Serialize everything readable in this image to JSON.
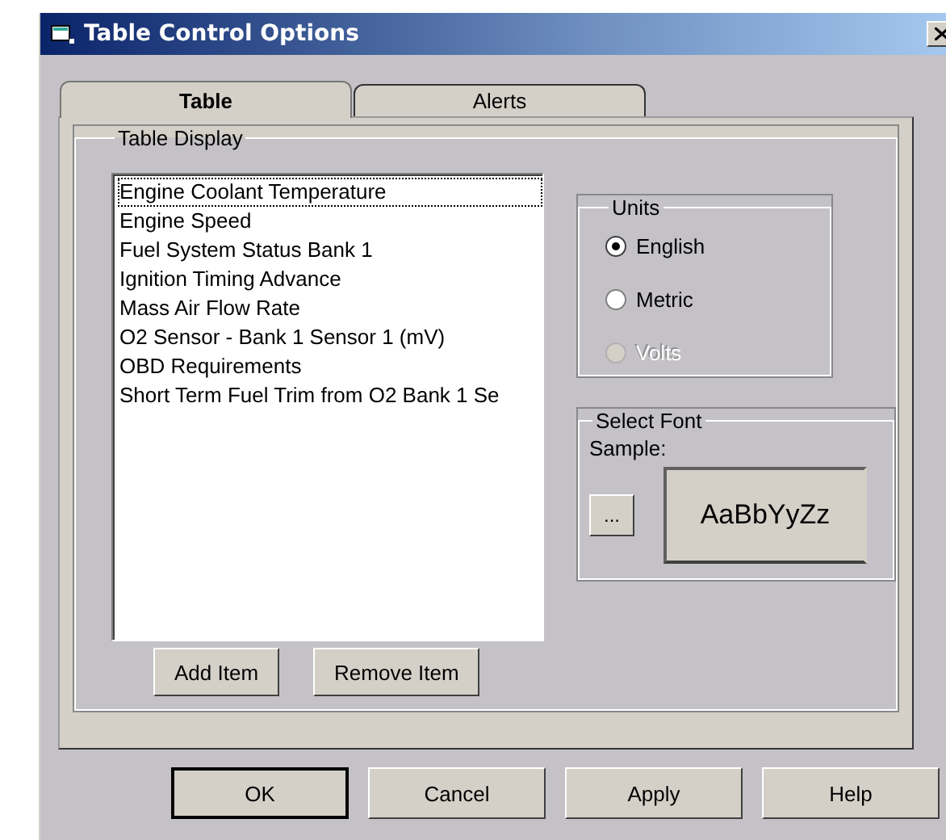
{
  "window": {
    "title": "Table Control Options"
  },
  "tabs": [
    {
      "label": "Table",
      "selected": true
    },
    {
      "label": "Alerts",
      "selected": false
    }
  ],
  "table_display": {
    "title": "Table Display",
    "list": [
      {
        "label": "Engine Coolant Temperature",
        "focused": true
      },
      {
        "label": "Engine Speed",
        "focused": false
      },
      {
        "label": "Fuel System Status Bank 1",
        "focused": false
      },
      {
        "label": "Ignition Timing Advance",
        "focused": false
      },
      {
        "label": "Mass Air Flow Rate",
        "focused": false
      },
      {
        "label": "O2 Sensor - Bank 1 Sensor 1 (mV)",
        "focused": false
      },
      {
        "label": "OBD Requirements",
        "focused": false
      },
      {
        "label": "Short Term Fuel Trim from O2 Bank 1 Se",
        "focused": false
      }
    ],
    "list_buttons": [
      "Add Item",
      "Remove Item"
    ],
    "units": {
      "title": "Units",
      "options": [
        {
          "label": "English",
          "selected": true,
          "disabled": false
        },
        {
          "label": "Metric",
          "selected": false,
          "disabled": false
        },
        {
          "label": "Volts",
          "selected": false,
          "disabled": true
        }
      ]
    },
    "font": {
      "title": "Select Font",
      "sample_label": "Sample:",
      "browse_button": "...",
      "sample_text": "AaBbYyZz"
    }
  },
  "buttons": [
    {
      "label": "OK",
      "default": true
    },
    {
      "label": "Cancel",
      "default": false
    },
    {
      "label": "Apply",
      "default": false
    },
    {
      "label": "Help",
      "default": false
    }
  ]
}
